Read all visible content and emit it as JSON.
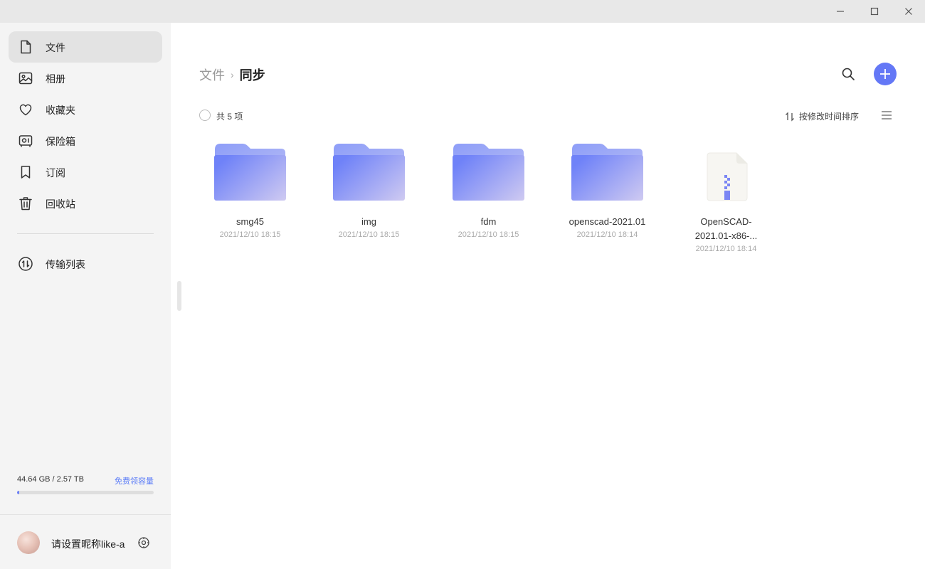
{
  "window": {
    "controls": [
      {
        "name": "minimize-icon"
      },
      {
        "name": "maximize-icon"
      },
      {
        "name": "close-icon"
      }
    ]
  },
  "sidebar": {
    "items": [
      {
        "label": "文件",
        "icon": "file-icon",
        "active": true
      },
      {
        "label": "相册",
        "icon": "image-icon"
      },
      {
        "label": "收藏夹",
        "icon": "heart-icon"
      },
      {
        "label": "保险箱",
        "icon": "safe-icon"
      },
      {
        "label": "订阅",
        "icon": "bookmark-icon"
      },
      {
        "label": "回收站",
        "icon": "trash-icon"
      }
    ],
    "transfer": {
      "label": "传输列表",
      "icon": "transfer-icon"
    },
    "storage": {
      "text": "44.64 GB / 2.57 TB",
      "link": "免费领容量",
      "used_fraction": 0.017,
      "accent": "#6b7ff7"
    },
    "user": {
      "name": "请设置昵称like-a",
      "icon": "settings-icon"
    }
  },
  "main": {
    "breadcrumb": {
      "parent": "文件",
      "separator": "›",
      "current": "同步"
    },
    "toolbar": {
      "count": "共 5 项",
      "sort_label": "按修改时间排序"
    },
    "files": [
      {
        "name": "smg45",
        "date": "2021/12/10 18:15",
        "type": "folder"
      },
      {
        "name": "img",
        "date": "2021/12/10 18:15",
        "type": "folder"
      },
      {
        "name": "fdm",
        "date": "2021/12/10 18:15",
        "type": "folder"
      },
      {
        "name": "openscad-2021.01",
        "date": "2021/12/10 18:14",
        "type": "folder"
      },
      {
        "name": "OpenSCAD-\n2021.01-x86-...",
        "date": "2021/12/10 18:14",
        "type": "zip"
      }
    ],
    "accent": "#6478f6"
  }
}
